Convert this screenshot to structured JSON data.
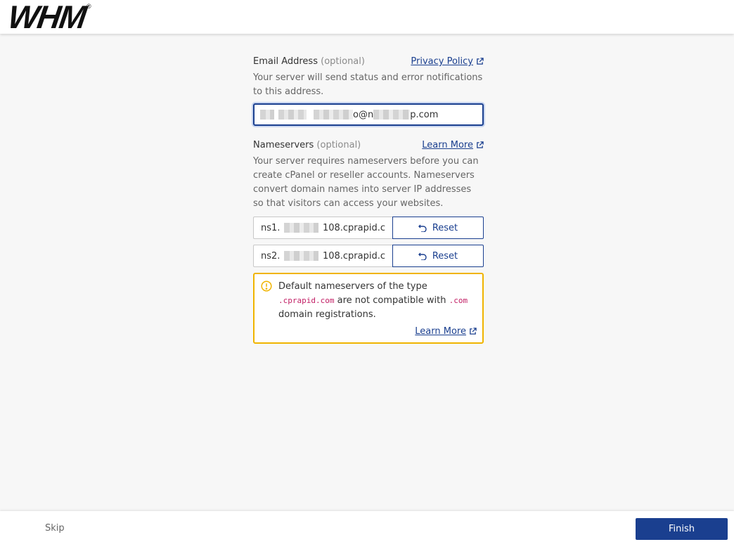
{
  "brand": {
    "logo_text": "WHM",
    "logo_reg": "®"
  },
  "email": {
    "label": "Email Address",
    "optional": "(optional)",
    "link": "Privacy Policy",
    "help": "Your server will send status and error notifications to this address.",
    "value_visible_1": "o@n",
    "value_visible_2": "p.com"
  },
  "nameservers": {
    "label": "Nameservers",
    "optional": "(optional)",
    "link": "Learn More",
    "help": "Your server requires nameservers before you can create cPanel or reseller accounts. Nameservers convert domain names into server IP addresses so that visitors can access your websites.",
    "rows": [
      {
        "prefix": "ns1.",
        "suffix": "108.cprapid.c",
        "button": "Reset"
      },
      {
        "prefix": "ns2.",
        "suffix": "108.cprapid.c",
        "button": "Reset"
      }
    ]
  },
  "warning": {
    "text_1": "Default nameservers of the type",
    "code_1": ".cprapid.com",
    "text_2": "are not compatible with",
    "code_2": ".com",
    "text_3": "domain registrations.",
    "link": "Learn More"
  },
  "footer": {
    "skip": "Skip",
    "finish": "Finish"
  },
  "colors": {
    "primary": "#1a3f8f",
    "warning_border": "#f0b400",
    "code": "#c21f65"
  }
}
